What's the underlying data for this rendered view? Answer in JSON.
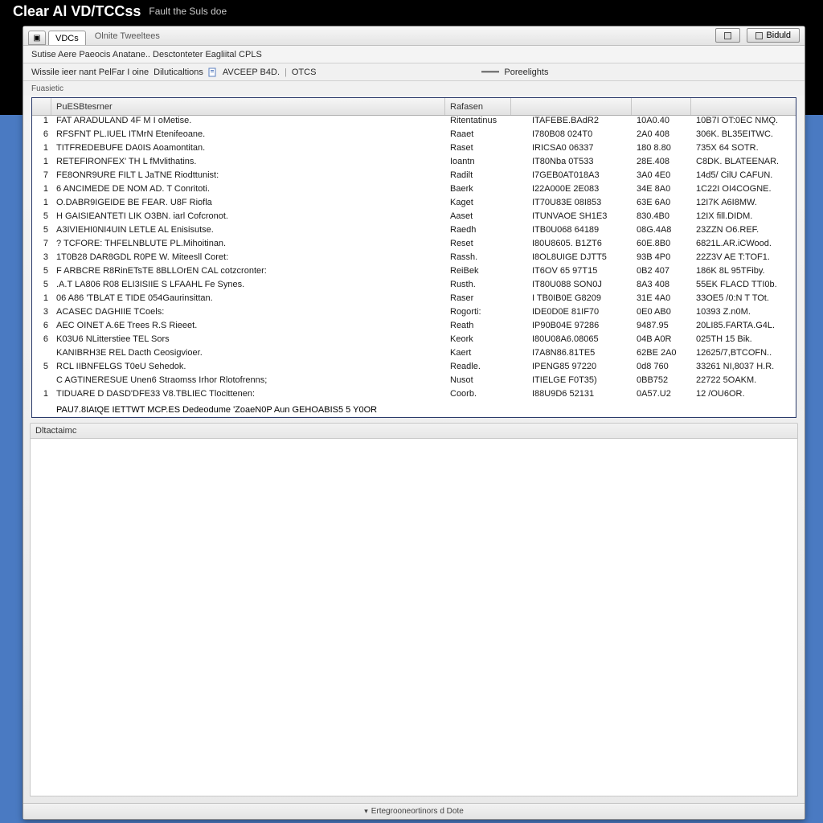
{
  "titlebar": {
    "main": "Clear Al VD/TCCss",
    "sub": "Fault the Suls doe"
  },
  "tabs": {
    "main": "VDCs",
    "sublabel": "Olnite Tweeltees"
  },
  "topbuttons": {
    "left_icon": "▣",
    "right1": "⧉",
    "right2": "Biduld"
  },
  "secline": "Sutise Aere Paeocis Anatane..   Desctonteter Eagliital CPLS",
  "toolrow": {
    "seg1": "Wissile ieer nant PelFar I oine",
    "seg2": "Diluticaltions",
    "seg3": "AVCEEP B4D.",
    "seg4": "OTCS",
    "right": "Poreelights"
  },
  "subfilter": "Fuasietic",
  "columns": {
    "c1": "PuESBtesrner",
    "c2": "Rafasen"
  },
  "rows": [
    {
      "idx": "1",
      "desc": "FAT ARADULAND 4F M I oMetise.",
      "reason": "Ritentatinus",
      "c3": "ITAFEBE.BAdR2",
      "c4": "10A0.40",
      "c5": "10B7I OT:0EC NMQ."
    },
    {
      "idx": "6",
      "desc": "RFSFNT PL.IUEL ITMrN Etenifeoane.",
      "reason": "Raaet",
      "c3": "I780B08 024T0",
      "c4": "2A0 408",
      "c5": "306K. BL35EITWC."
    },
    {
      "idx": "1",
      "desc": "TITFREDEBUFE DA0IS Aoamontitan.",
      "reason": "Raset",
      "c3": "IRICSA0 06337",
      "c4": "180 8.80",
      "c5": "735X 64 SOTR."
    },
    {
      "idx": "1",
      "desc": "RETEFIRONFEX' TH L   fMvlithatins.",
      "reason": "Ioantn",
      "c3": "IT80Nba 0T533",
      "c4": "28E.408",
      "c5": "C8DK. BLATEENAR."
    },
    {
      "idx": "7",
      "desc": "FE8ONR9URE FILT L JaTNE Riodttunist:",
      "reason": "Radilt",
      "c3": "I7GEB0AT018A3",
      "c4": "3A0 4E0",
      "c5": "14d5/ CilU CAFUN."
    },
    {
      "idx": "1",
      "desc": "6 ANCIMEDE DE NOM AD. T Conritoti.",
      "reason": "Baerk",
      "c3": "I22A000E 2E083",
      "c4": "34E 8A0",
      "c5": "1C22I OI4COGNE."
    },
    {
      "idx": "1",
      "desc": "O.DABR9IGEIDE BE FEAR. U8F Riofla",
      "reason": "Kaget",
      "c3": "IT70U83E 08I853",
      "c4": "63E 6A0",
      "c5": "12I7K A6I8MW."
    },
    {
      "idx": "5",
      "desc": "H GAISIEANTETI LIK O3BN. iarl Cofcronot.",
      "reason": "Aaset",
      "c3": "ITUNVAOE SH1E3",
      "c4": "830.4B0",
      "c5": "12IX fill.DIDM."
    },
    {
      "idx": "5",
      "desc": "A3IVIEHI0NI4UIN LETLE AL Enisisutse.",
      "reason": "Raedh",
      "c3": "ITB0U068 64189",
      "c4": "08G.4A8",
      "c5": "23ZZN O6.REF."
    },
    {
      "idx": "7",
      "desc": "? TCFORE: THFELNBLUTE PL.Mihoitinan.",
      "reason": "Reset",
      "c3": "I80U8605. B1ZT6",
      "c4": "60E.8B0",
      "c5": "6821L.AR.iCWood."
    },
    {
      "idx": "3",
      "desc": "1T0B28 DAR8GDL R0PE W. Miteesll Coret:",
      "reason": "Rassh.",
      "c3": "I8OL8UIGE DJTT5",
      "c4": "93B 4P0",
      "c5": "22Z3V AE T:TOF1."
    },
    {
      "idx": "5",
      "desc": "F ARBCRE R8RinETsTE 8BLLOrEN CAL cotzcronter:",
      "reason": "ReiBek",
      "c3": "IT6OV 65 97T15",
      "c4": "0B2 407",
      "c5": "186K 8L 95TFiby."
    },
    {
      "idx": "5",
      "desc": ".A.T LA806 R08 ELI3ISIIE S LFAAHL Fe Synes.",
      "reason": "Rusth.",
      "c3": "IT80U088 SON0J",
      "c4": "8A3 408",
      "c5": "55EK  FLACD TTI0b."
    },
    {
      "idx": "1",
      "desc": "06 A86 'TBLAT E TIDE 054Gaurinsittan.",
      "reason": "Raser",
      "c3": "I TB0IB0E G8209",
      "c4": "31E 4A0",
      "c5": "33OE5 /0:N T TOt."
    },
    {
      "idx": "3",
      "desc": "ACASEC DAGHIIE TCoels:",
      "reason": "Rogorti:",
      "c3": "IDE0D0E 81IF70",
      "c4": "0E0 AB0",
      "c5": "10393 Z.n0M."
    },
    {
      "idx": "6",
      "desc": "AEC OINET A.6E Trees  R.S Rieeet.",
      "reason": "Reath",
      "c3": "IP90B04E 97286",
      "c4": "9487.95",
      "c5": "20LI85.FARTA.G4L."
    },
    {
      "idx": "6",
      "desc": "K03U6 NLitterstiee  TEL Sors",
      "reason": "Keork",
      "c3": "I80U08A6.08065",
      "c4": "04B A0R",
      "c5": "025TH 15 Bik."
    },
    {
      "idx": "",
      "desc": "KANIBRH3E REL Dacth Ceosigvioer.",
      "reason": "Kaert",
      "c3": "I7A8N86.81TE5",
      "c4": "62BE 2A0",
      "c5": "12625/7,BTCOFN.."
    },
    {
      "idx": "5",
      "desc": "RCL IIBNFELGS T0eU Sehedok.",
      "reason": "Readle.",
      "c3": "IPENG85 97220",
      "c4": "0d8 760",
      "c5": "33261 NI,8037 H.R."
    },
    {
      "idx": "",
      "desc": "C AGTINERESUE  Unen6 Straomss Irhor Rlotofrenns;",
      "reason": "Nusot",
      "c3": "ITIELGE F0T35)",
      "c4": "0BB752",
      "c5": "22722 5OAKM."
    },
    {
      "idx": "1",
      "desc": "TIDUARE D DASD'DFE33 V8.TBLIEC Tlocittenen:",
      "reason": "Coorb.",
      "c3": "I88U9D6 52131",
      "c4": "0A57.U2",
      "c5": "12 /OU6OR."
    }
  ],
  "footer_row": "PAU7.8IAtQE IETTWT MCP.ES Dedeodume  'ZoaeN0P Aun GEHOABIS5 5 Y0OR",
  "details_header": "Dltactaimc",
  "statusbar": "Ertegrooneortinors d Dote"
}
